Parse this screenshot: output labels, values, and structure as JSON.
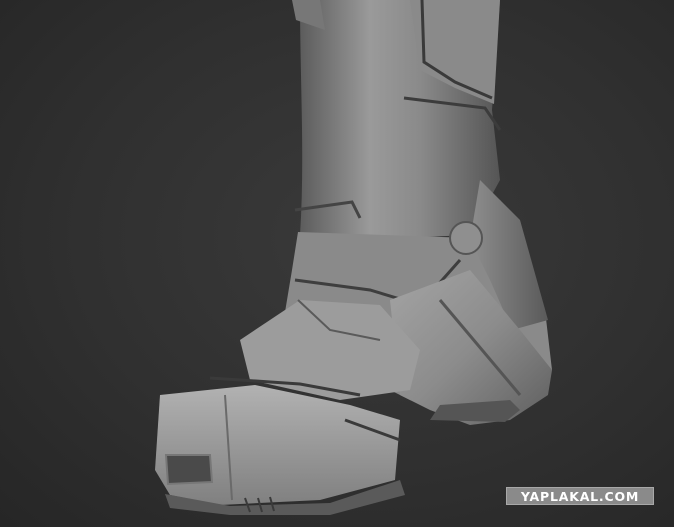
{
  "watermark": {
    "text": "YAPLAKAL.COM"
  },
  "colors": {
    "background": "#2f2f2f",
    "model_light": "#9c9c9c",
    "model_mid": "#7a7a7a",
    "model_shadow": "#4a4a4a",
    "watermark_bg": "#8a8a8a",
    "watermark_text": "#ffffff"
  }
}
